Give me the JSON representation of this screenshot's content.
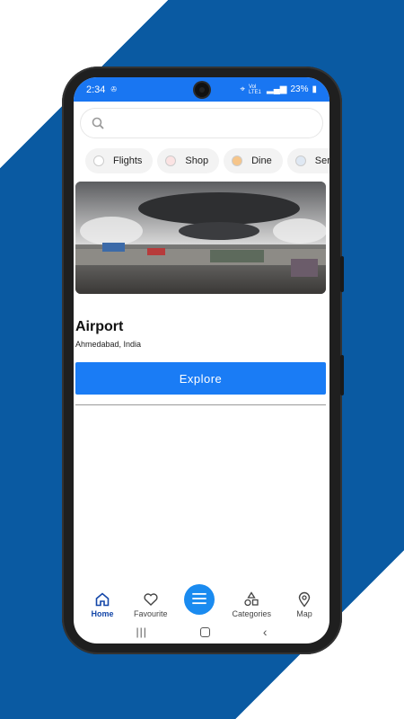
{
  "status": {
    "time": "2:34",
    "signal_text": "Vol LTE1",
    "battery": "23%"
  },
  "search": {
    "placeholder": ""
  },
  "chips": [
    {
      "label": "Flights",
      "icon": "plane-icon"
    },
    {
      "label": "Shop",
      "icon": "shop-icon"
    },
    {
      "label": "Dine",
      "icon": "dine-icon"
    },
    {
      "label": "Ser",
      "icon": "service-icon"
    }
  ],
  "place": {
    "title": "Airport",
    "location": "Ahmedabad, India",
    "explore_label": "Explore"
  },
  "nav": {
    "home": "Home",
    "favourite": "Favourite",
    "categories": "Categories",
    "map": "Map"
  },
  "colors": {
    "accent": "#1a7cf5",
    "status_bar": "#1976f2",
    "background_band": "#0a5aa2"
  }
}
